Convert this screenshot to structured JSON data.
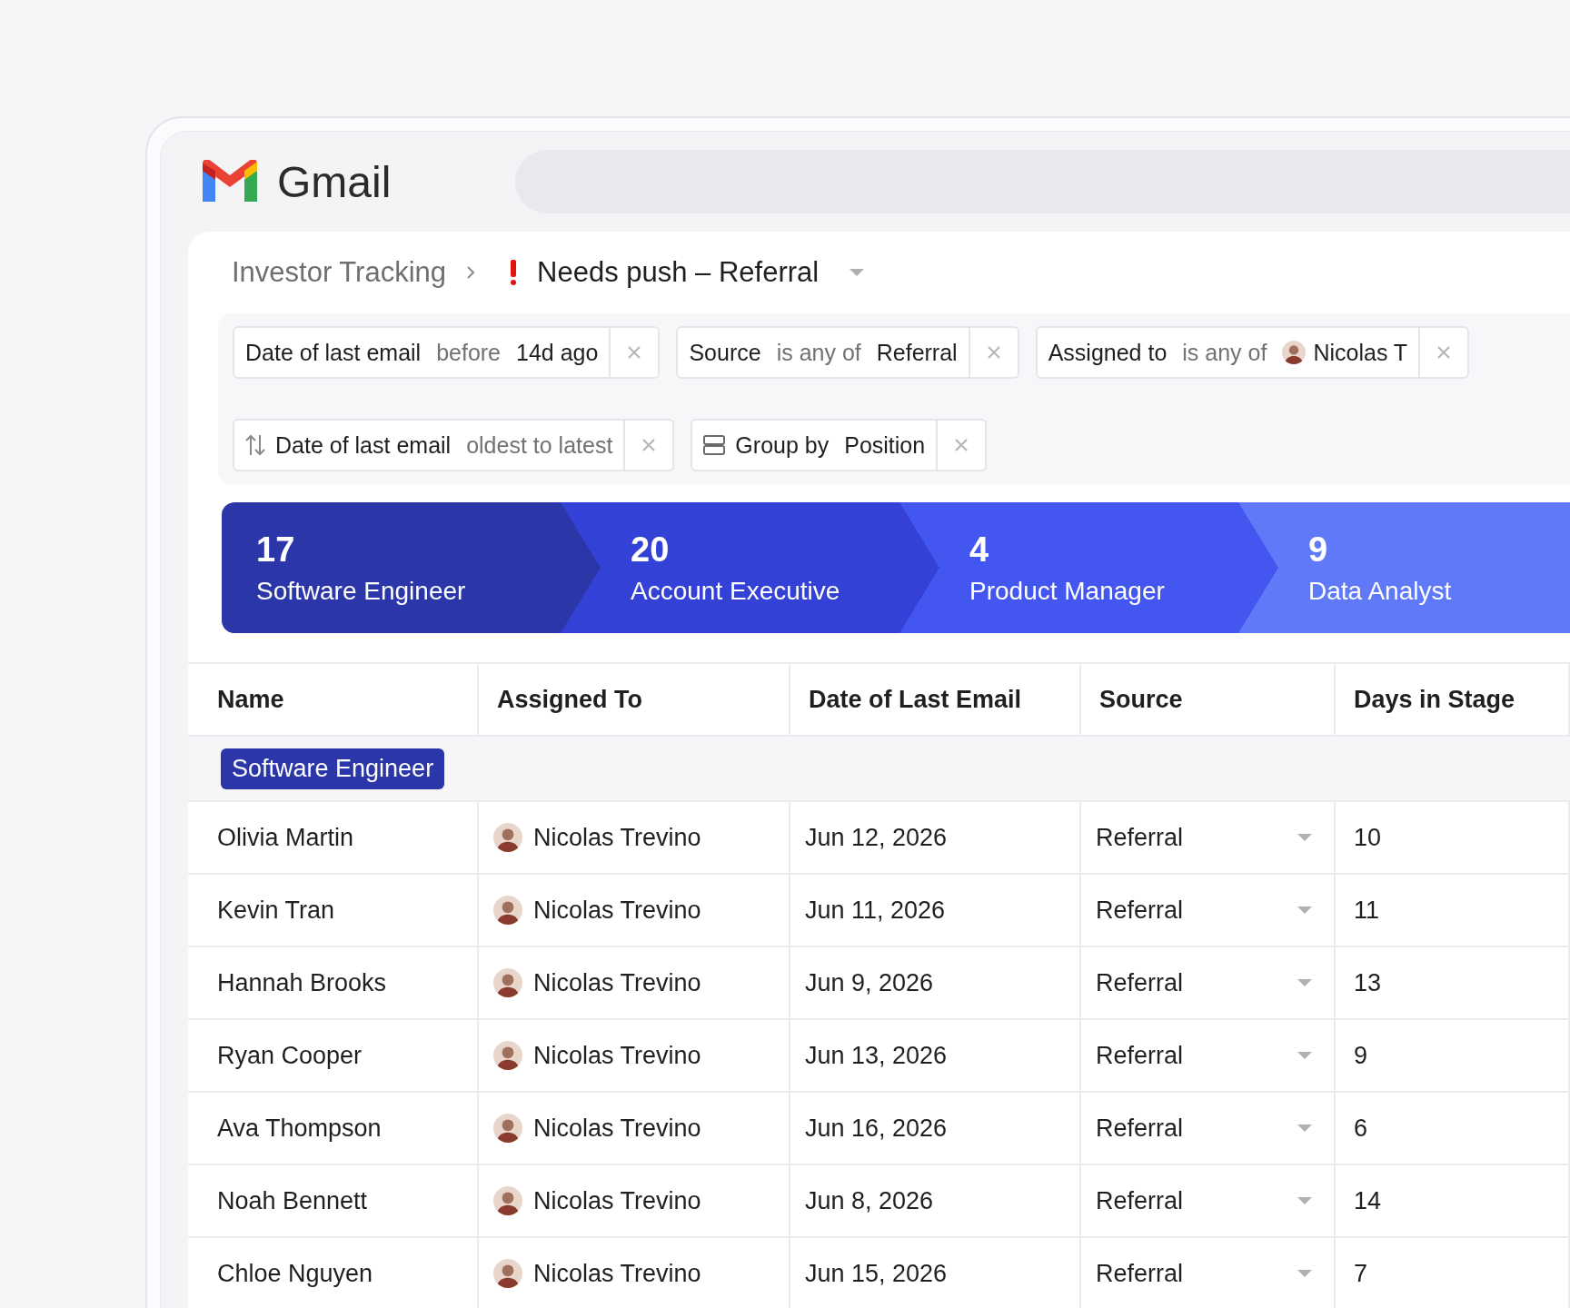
{
  "header": {
    "logo_text": "Gmail"
  },
  "breadcrumb": {
    "parent": "Investor Tracking",
    "current": "Needs push – Referral",
    "priority": true
  },
  "filters": [
    {
      "field": "Date of last email",
      "operator": "before",
      "value": "14d ago",
      "avatar": false
    },
    {
      "field": "Source",
      "operator": "is any of",
      "value": "Referral",
      "avatar": false
    },
    {
      "field": "Assigned to",
      "operator": "is any of",
      "value": "Nicolas T",
      "avatar": true
    }
  ],
  "view_options": [
    {
      "kind": "sort",
      "field": "Date of last email",
      "operator": "oldest to latest"
    },
    {
      "kind": "group",
      "field": "Group by",
      "value": "Position"
    }
  ],
  "stages": [
    {
      "count": "17",
      "label": "Software Engineer",
      "color": "#2b36a8"
    },
    {
      "count": "20",
      "label": "Account Executive",
      "color": "#3441d6"
    },
    {
      "count": "4",
      "label": "Product Manager",
      "color": "#4356ef"
    },
    {
      "count": "9",
      "label": "Data Analyst",
      "color": "#5f79f8"
    }
  ],
  "table": {
    "columns": [
      "Name",
      "Assigned To",
      "Date of Last Email",
      "Source",
      "Days in Stage"
    ],
    "groups": [
      {
        "label": "Software Engineer",
        "color": "#2b36a8",
        "rows": [
          {
            "name": "Olivia Martin",
            "assigned_to": "Nicolas Trevino",
            "date": "Jun 12, 2026",
            "source": "Referral",
            "days": "10"
          },
          {
            "name": "Kevin Tran",
            "assigned_to": "Nicolas Trevino",
            "date": "Jun 11, 2026",
            "source": "Referral",
            "days": "11"
          },
          {
            "name": "Hannah Brooks",
            "assigned_to": "Nicolas Trevino",
            "date": "Jun 9, 2026",
            "source": "Referral",
            "days": "13"
          },
          {
            "name": "Ryan Cooper",
            "assigned_to": "Nicolas Trevino",
            "date": "Jun 13, 2026",
            "source": "Referral",
            "days": "9"
          },
          {
            "name": "Ava Thompson",
            "assigned_to": "Nicolas Trevino",
            "date": "Jun 16, 2026",
            "source": "Referral",
            "days": "6"
          },
          {
            "name": "Noah Bennett",
            "assigned_to": "Nicolas Trevino",
            "date": "Jun 8, 2026",
            "source": "Referral",
            "days": "14"
          },
          {
            "name": "Chloe Nguyen",
            "assigned_to": "Nicolas Trevino",
            "date": "Jun 15, 2026",
            "source": "Referral",
            "days": "7"
          }
        ]
      }
    ]
  }
}
